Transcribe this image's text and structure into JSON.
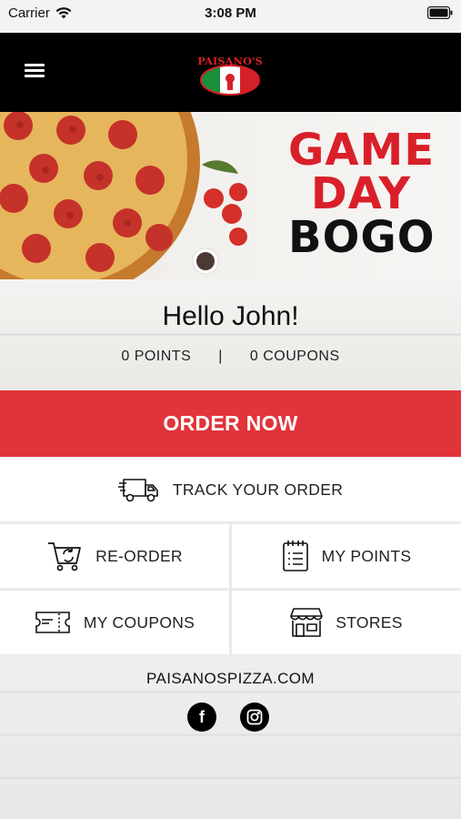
{
  "status_bar": {
    "carrier": "Carrier",
    "time": "3:08 PM"
  },
  "nav": {
    "logo_text": "PAISANO'S",
    "icons": [
      "menu-icon",
      "logo"
    ]
  },
  "hero": {
    "line1": "GAME",
    "line2": "DAY",
    "line3": "BOGO",
    "colors": {
      "accent": "#d9202a",
      "dark": "#111111"
    }
  },
  "greeting": {
    "text": "Hello John!",
    "points": "0 POINTS",
    "separator": "|",
    "coupons": "0 COUPONS"
  },
  "actions": {
    "order_now": "ORDER NOW",
    "track_order": "TRACK YOUR ORDER",
    "reorder": "RE-ORDER",
    "my_points": "MY POINTS",
    "my_coupons": "MY COUPONS",
    "stores": "STORES",
    "accent_color": "#e1333a"
  },
  "footer": {
    "website": "PAISANOSPIZZA.COM",
    "social": [
      "facebook-icon",
      "instagram-icon"
    ]
  }
}
